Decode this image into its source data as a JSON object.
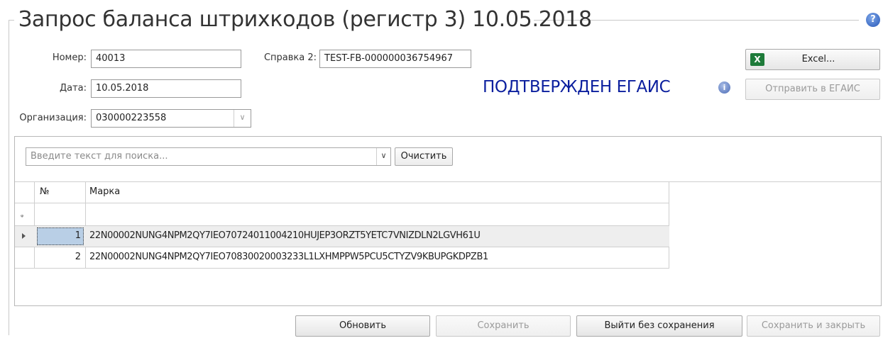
{
  "window": {
    "title": "Запрос баланса штрихкодов (регистр 3) 10.05.2018",
    "help_glyph": "?"
  },
  "form": {
    "number_label": "Номер:",
    "number_value": "40013",
    "ref2_label": "Справка 2:",
    "ref2_value": "TEST-FB-000000036754967",
    "date_label": "Дата:",
    "date_value": "10.05.2018",
    "org_label": "Организация:",
    "org_value": "030000223558"
  },
  "status": {
    "text": "ПОДТВЕРЖДЕН ЕГАИС",
    "color": "#0b1f9e",
    "info_glyph": "i"
  },
  "actions": {
    "excel_label": "Excel...",
    "send_egais_label": "Отправить в ЕГАИС"
  },
  "search": {
    "placeholder": "Введите текст для поиска...",
    "clear_label": "Очистить"
  },
  "table": {
    "columns": [
      "№",
      "Марка"
    ],
    "pin_glyph": "ᵩ",
    "rows": [
      {
        "num": "1",
        "mark": "22N00002NUNG4NPM2QY7IEO70724011004210HUJEP3ORZT5YETC7VNIZDLN2LGVH61U",
        "selected": true
      },
      {
        "num": "2",
        "mark": "22N00002NUNG4NPM2QY7IEO70830020003233L1LXHMPPW5PCU5CTYZV9KBUPGKDPZB1",
        "selected": false
      }
    ]
  },
  "footer": {
    "refresh_label": "Обновить",
    "save_label": "Сохранить",
    "exit_label": "Выйти без сохранения",
    "save_close_label": "Сохранить и закрыть"
  }
}
